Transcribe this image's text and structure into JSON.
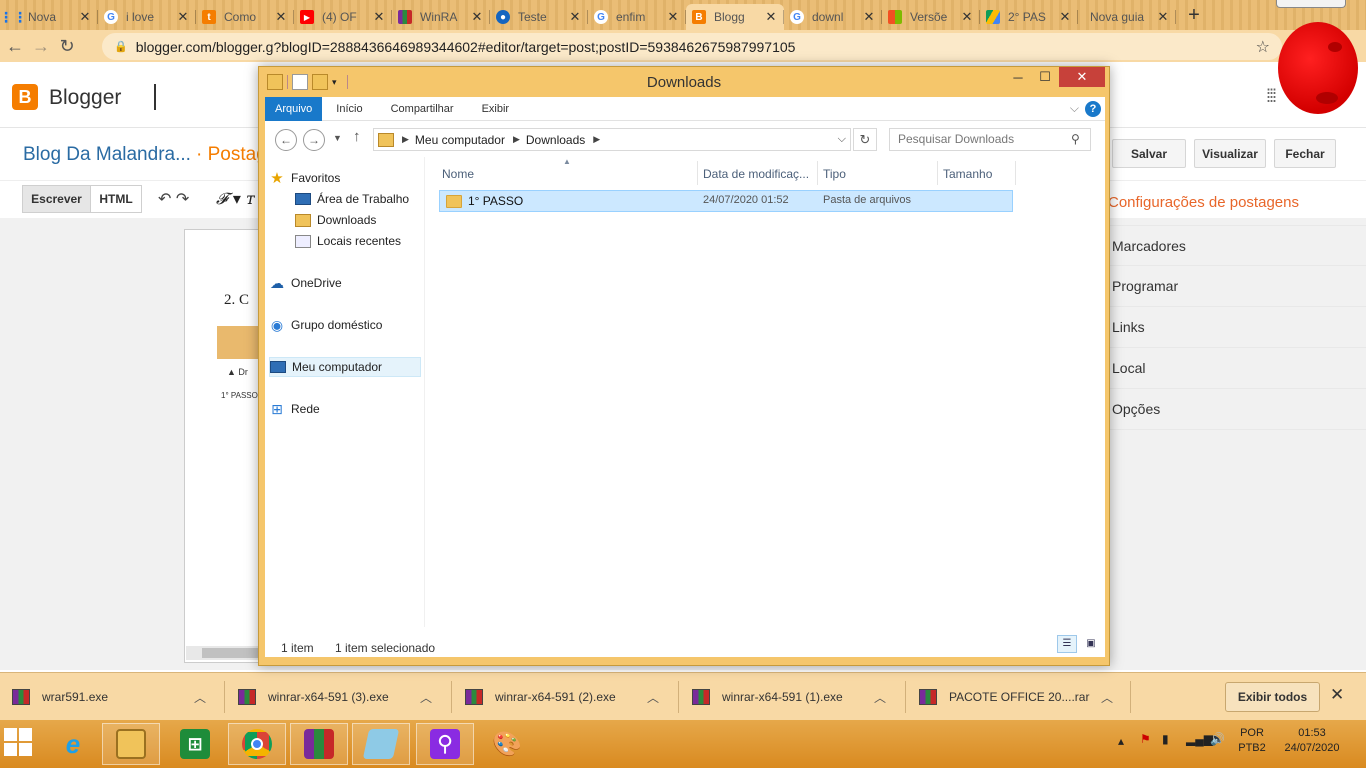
{
  "browser": {
    "tabs": [
      {
        "label": "Nova",
        "favicon": "apps-icon",
        "color": "#1a73e8"
      },
      {
        "label": "i love",
        "favicon": "google-icon",
        "color": "#4285f4"
      },
      {
        "label": "Como",
        "favicon": "tt-icon",
        "color": "#f57d00"
      },
      {
        "label": "(4) OF",
        "favicon": "youtube-icon",
        "color": "#ff0000"
      },
      {
        "label": "WinRA",
        "favicon": "winrar-icon",
        "color": "#8e24aa"
      },
      {
        "label": "Teste",
        "favicon": "person-icon",
        "color": "#1565c0"
      },
      {
        "label": "enfim",
        "favicon": "google-icon",
        "color": "#4285f4"
      },
      {
        "label": "Blogg",
        "favicon": "blogger-icon",
        "color": "#f57d00"
      },
      {
        "label": "downl",
        "favicon": "google-icon",
        "color": "#4285f4"
      },
      {
        "label": "Versõe",
        "favicon": "microsoft-icon",
        "color": "#f25022"
      },
      {
        "label": "2° PAS",
        "favicon": "drive-icon",
        "color": "#0f9d58"
      },
      {
        "label": "Nova guia",
        "favicon": "",
        "color": ""
      }
    ],
    "active_tab_index": 7,
    "url": "blogger.com/blogger.g?blogID=2888436646989344602#editor/target=post;postID=5938462675987997105"
  },
  "blogger": {
    "brand": "Blogger",
    "blog_title": "Blog Da Malandra...",
    "post_label": "· Postag",
    "buttons": {
      "save": "Salvar",
      "preview": "Visualizar",
      "close": "Fechar"
    },
    "modes": {
      "compose": "Escrever",
      "html": "HTML"
    },
    "editor_text": "2.  C",
    "editor_img_text": {
      "folder": "1° PASSO",
      "drive": "Dr"
    },
    "sidebar": {
      "title": "Configurações de postagens",
      "items": [
        "Marcadores",
        "Programar",
        "Links",
        "Local",
        "Opções"
      ]
    }
  },
  "explorer": {
    "title": "Downloads",
    "ribbon_tabs": [
      "Arquivo",
      "Início",
      "Compartilhar",
      "Exibir"
    ],
    "path": [
      "Meu computador",
      "Downloads"
    ],
    "search_placeholder": "Pesquisar Downloads",
    "nav": {
      "favorites": "Favoritos",
      "favorites_items": [
        "Área de Trabalho",
        "Downloads",
        "Locais recentes"
      ],
      "onedrive": "OneDrive",
      "homegroup": "Grupo doméstico",
      "computer": "Meu computador",
      "network": "Rede"
    },
    "columns": [
      "Nome",
      "Data de modificaç...",
      "Tipo",
      "Tamanho"
    ],
    "files": [
      {
        "name": "1° PASSO",
        "modified": "24/07/2020 01:52",
        "type": "Pasta de arquivos",
        "size": ""
      }
    ],
    "status": {
      "count": "1 item",
      "selected": "1 item selecionado"
    }
  },
  "downloads_shelf": {
    "items": [
      "wrar591.exe",
      "winrar-x64-591 (3).exe",
      "winrar-x64-591 (2).exe",
      "winrar-x64-591 (1).exe",
      "PACOTE OFFICE 20....rar"
    ],
    "show_all": "Exibir todos"
  },
  "taskbar": {
    "apps": [
      "internet-explorer-icon",
      "file-explorer-icon",
      "store-icon",
      "chrome-icon",
      "winrar-icon",
      "notepad-icon",
      "search-magnifier-icon",
      "paint-icon"
    ],
    "language": "POR",
    "keyboard": "PTB2",
    "time": "01:53",
    "date": "24/07/2020"
  }
}
